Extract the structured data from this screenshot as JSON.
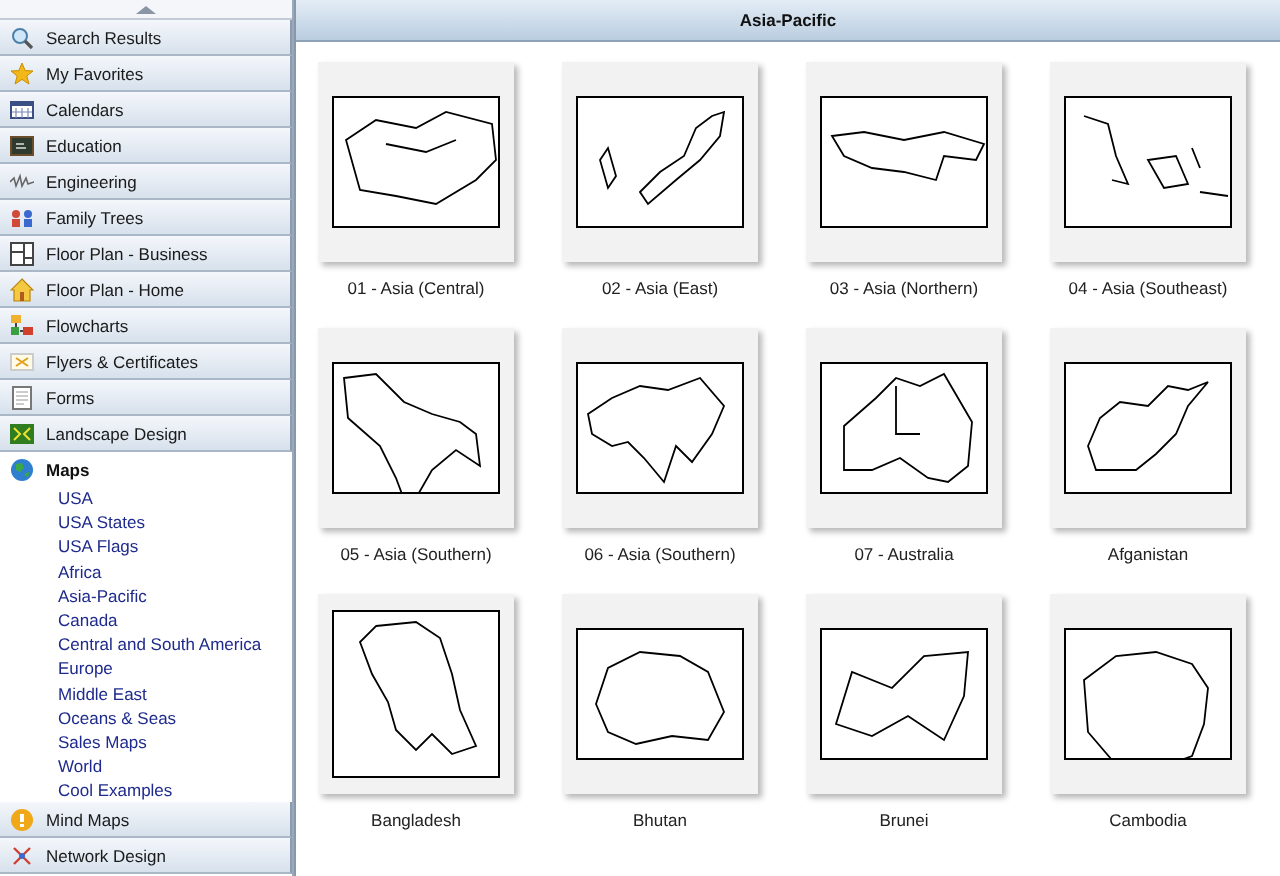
{
  "sidebar": {
    "categories": [
      {
        "label": "Search Results",
        "expanded": false
      },
      {
        "label": "My Favorites",
        "expanded": false
      },
      {
        "label": "Calendars",
        "expanded": false
      },
      {
        "label": "Education",
        "expanded": false
      },
      {
        "label": "Engineering",
        "expanded": false
      },
      {
        "label": "Family Trees",
        "expanded": false
      },
      {
        "label": "Floor Plan - Business",
        "expanded": false
      },
      {
        "label": "Floor Plan - Home",
        "expanded": false
      },
      {
        "label": "Flowcharts",
        "expanded": false
      },
      {
        "label": "Flyers & Certificates",
        "expanded": false
      },
      {
        "label": "Forms",
        "expanded": false
      },
      {
        "label": "Landscape Design",
        "expanded": false
      },
      {
        "label": "Maps",
        "expanded": true,
        "children": [
          "USA",
          "USA States",
          "USA Flags",
          "Africa",
          "Asia-Pacific",
          "Canada",
          "Central and South America",
          "Europe",
          "Middle East",
          "Oceans & Seas",
          "Sales Maps",
          "World",
          "Cool Examples"
        ]
      },
      {
        "label": "Mind Maps",
        "expanded": false
      },
      {
        "label": "Network Design",
        "expanded": false
      }
    ]
  },
  "gallery": {
    "title": "Asia-Pacific",
    "items": [
      {
        "label": "01 - Asia (Central)"
      },
      {
        "label": "02 - Asia (East)"
      },
      {
        "label": "03 - Asia (Northern)"
      },
      {
        "label": "04 - Asia (Southeast)"
      },
      {
        "label": "05 - Asia (Southern)"
      },
      {
        "label": "06 - Asia (Southern)"
      },
      {
        "label": "07 - Australia"
      },
      {
        "label": "Afganistan"
      },
      {
        "label": "Bangladesh"
      },
      {
        "label": "Bhutan"
      },
      {
        "label": "Brunei"
      },
      {
        "label": "Cambodia"
      }
    ]
  }
}
